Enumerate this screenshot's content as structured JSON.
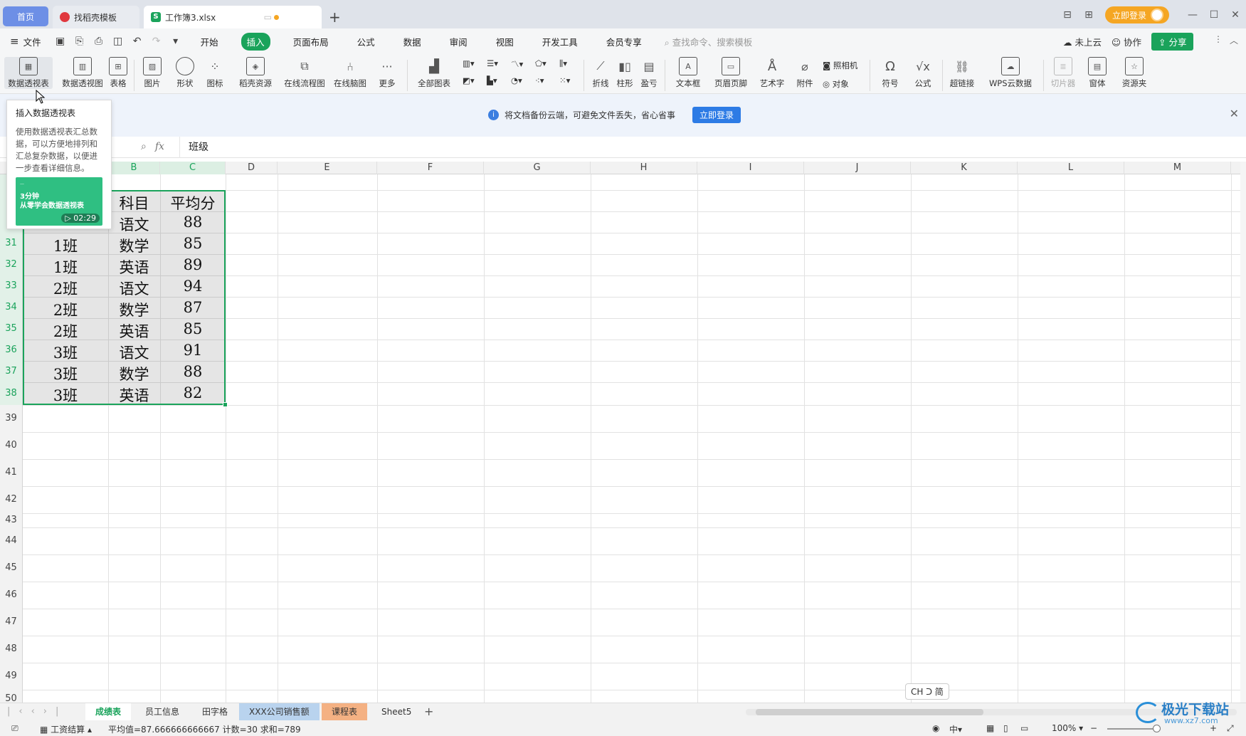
{
  "tabs": {
    "home": "首页",
    "template": "找稻壳模板",
    "file": "工作簿3.xlsx",
    "add": "+"
  },
  "topright": {
    "login": "立即登录"
  },
  "menubar": {
    "file": "文件",
    "items": [
      "开始",
      "插入",
      "页面布局",
      "公式",
      "数据",
      "审阅",
      "视图",
      "开发工具",
      "会员专享"
    ],
    "active": "插入",
    "search_placeholder": "查找命令、搜索模板",
    "cloud": "未上云",
    "collab": "协作",
    "share": "分享"
  },
  "ribbon": {
    "buttons": [
      "数据透视表",
      "数据透视图",
      "表格",
      "图片",
      "形状",
      "图标",
      "稻壳资源",
      "在线流程图",
      "在线脑图",
      "更多",
      "全部图表",
      "折线",
      "柱形",
      "盈亏",
      "文本框",
      "页眉页脚",
      "艺术字",
      "附件",
      "照相机",
      "对象",
      "符号",
      "公式",
      "超链接",
      "WPS云数据",
      "切片器",
      "窗体",
      "资源夹"
    ]
  },
  "infobar": {
    "message": "将文档备份云端，可避免文件丢失，省心省事",
    "button": "立即登录"
  },
  "formula": {
    "fx": "fx",
    "value": "班级"
  },
  "tooltip": {
    "title": "插入数据透视表",
    "desc": "使用数据透视表汇总数据，可以方便地排列和汇总复杂数据，以便进一步查看详细信息。",
    "thumb_line1": "3分钟",
    "thumb_line2": "从零学会数据透视表",
    "duration": "02:29"
  },
  "columns": [
    "B",
    "C",
    "D",
    "E",
    "F",
    "G",
    "H",
    "I",
    "J",
    "K",
    "L",
    "M"
  ],
  "rows": [
    "31",
    "32",
    "33",
    "34",
    "35",
    "36",
    "37",
    "38",
    "39",
    "40",
    "41",
    "42",
    "43",
    "44",
    "45",
    "46",
    "47",
    "48",
    "49",
    "50"
  ],
  "table": {
    "header": [
      "科目",
      "平均分"
    ],
    "row30": [
      "语文",
      "88"
    ],
    "rows": [
      [
        "1班",
        "数学",
        "85"
      ],
      [
        "1班",
        "英语",
        "89"
      ],
      [
        "2班",
        "语文",
        "94"
      ],
      [
        "2班",
        "数学",
        "87"
      ],
      [
        "2班",
        "英语",
        "85"
      ],
      [
        "3班",
        "语文",
        "91"
      ],
      [
        "3班",
        "数学",
        "88"
      ],
      [
        "3班",
        "英语",
        "82"
      ]
    ]
  },
  "ime": "CH ᑐ 简",
  "sheets": [
    {
      "name": "成绩表",
      "active": true,
      "color": ""
    },
    {
      "name": "员工信息",
      "active": false,
      "color": ""
    },
    {
      "name": "田字格",
      "active": false,
      "color": ""
    },
    {
      "name": "XXX公司销售额",
      "active": false,
      "color": "#b9d3ee"
    },
    {
      "name": "课程表",
      "active": false,
      "color": "#f4b183"
    },
    {
      "name": "Sheet5",
      "active": false,
      "color": ""
    }
  ],
  "status": {
    "mode": "工资结算",
    "stats": "平均值=87.666666666667  计数=30  求和=789",
    "zoom": "100%"
  },
  "watermark": {
    "title": "极光下载站",
    "url": "www.xz7.com"
  }
}
